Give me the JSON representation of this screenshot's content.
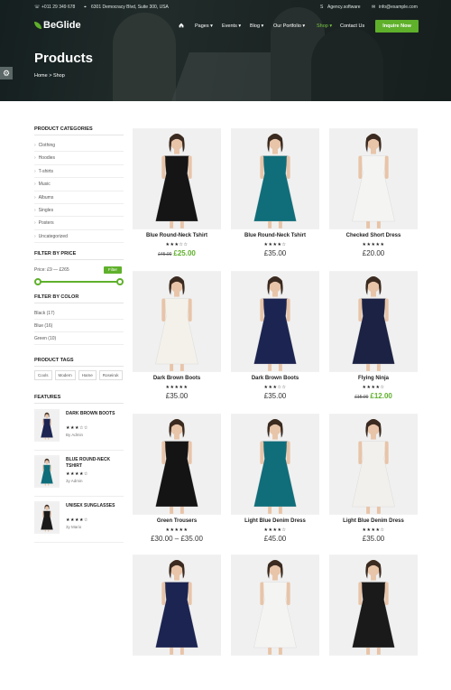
{
  "topbar": {
    "phone": "+011 29 349 678",
    "address": "6301 Democracy Blvd, Suite 300, USA",
    "skype": "Agency.software",
    "email": "info@example.com"
  },
  "brand": {
    "logo": "BeGlide",
    "accent": "#5fb02b"
  },
  "nav": {
    "items": [
      "Pages ▾",
      "Events ▾",
      "Blog ▾",
      "Our Portfolio ▾",
      "Shop ▾",
      "Contact Us"
    ],
    "active_index": 4,
    "cta": "Inquire Now"
  },
  "hero": {
    "title": "Products",
    "breadcrumb": "Home > Shop"
  },
  "sidebar": {
    "categories_title": "PRODUCT CATEGORIES",
    "categories": [
      "Clothing",
      "Hoodies",
      "T-shirts",
      "Music",
      "Albums",
      "Singles",
      "Posters",
      "Uncategorized"
    ],
    "price_title": "FILTER BY PRICE",
    "price_label": "Price: £9 — £265",
    "filter_button": "Filter",
    "price_range": [
      9,
      265
    ],
    "color_title": "FILTER BY COLOR",
    "colors": [
      "Black (17)",
      "Blue (16)",
      "Green (10)"
    ],
    "tags_title": "PRODUCT TAGS",
    "tags": [
      "Cools",
      "Modern",
      "Hame",
      "Roseiruk"
    ],
    "features_title": "FEATURES",
    "features": [
      {
        "title": "DARK BROWN BOOTS",
        "stars": "★★★☆☆",
        "by": "By Admin"
      },
      {
        "title": "BLUE ROUND-NECK TSHIRT",
        "stars": "★★★★☆",
        "by": "3y Admin"
      },
      {
        "title": "UNISEX SUNGLASSES",
        "stars": "★★★★☆",
        "by": "3y Mario"
      }
    ]
  },
  "products": [
    {
      "name": "Blue Round-Neck Tshirt",
      "stars": "★★★☆☆",
      "old_price": "£45.00",
      "price": "£25.00",
      "dress": "#151515"
    },
    {
      "name": "Blue Round-Neck Tshirt",
      "stars": "★★★★☆",
      "old_price": "",
      "price": "£35.00",
      "dress": "#0f6e7a"
    },
    {
      "name": "Checked Short Dress",
      "stars": "★★★★★",
      "old_price": "",
      "price": "£20.00",
      "dress": "#f4f4f2"
    },
    {
      "name": "Dark Brown Boots",
      "stars": "★★★★★",
      "old_price": "",
      "price": "£35.00",
      "dress": "#f3f1ea"
    },
    {
      "name": "Dark Brown Boots",
      "stars": "★★★☆☆",
      "old_price": "",
      "price": "£35.00",
      "dress": "#1c2452"
    },
    {
      "name": "Flying Ninja",
      "stars": "★★★★☆",
      "old_price": "£15.00",
      "price": "£12.00",
      "dress": "#1b2244"
    },
    {
      "name": "Green Trousers",
      "stars": "★★★★★",
      "old_price": "",
      "price": "£30.00 – £35.00",
      "dress": "#141414"
    },
    {
      "name": "Light Blue Denim Dress",
      "stars": "★★★★☆",
      "old_price": "",
      "price": "£45.00",
      "dress": "#0f6e7a"
    },
    {
      "name": "Light Blue Denim Dress",
      "stars": "★★★★☆",
      "old_price": "",
      "price": "£35.00",
      "dress": "#f2f0ec"
    },
    {
      "name": "",
      "stars": "",
      "old_price": "",
      "price": "",
      "dress": "#1c2452"
    },
    {
      "name": "",
      "stars": "",
      "old_price": "",
      "price": "",
      "dress": "#f4f4f2"
    },
    {
      "name": "",
      "stars": "",
      "old_price": "",
      "price": "",
      "dress": "#1a1a1a"
    }
  ]
}
